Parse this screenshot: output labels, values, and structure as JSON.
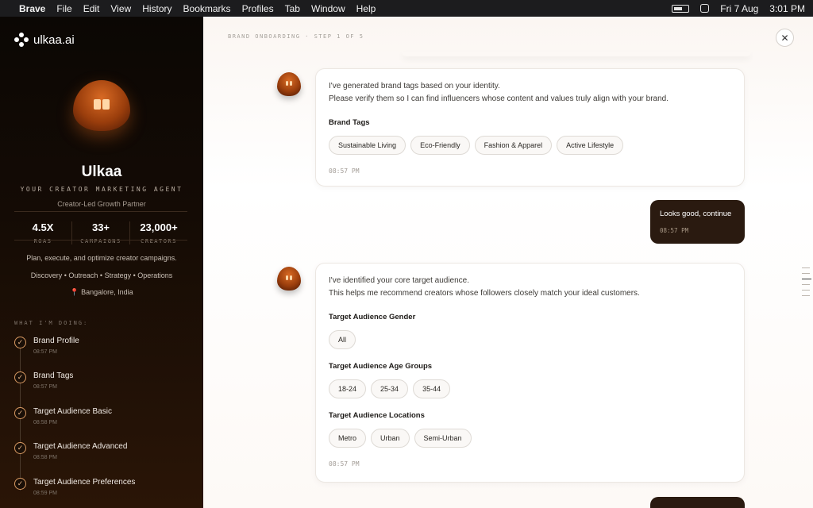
{
  "menubar": {
    "app": "Brave",
    "items": [
      "File",
      "Edit",
      "View",
      "History",
      "Bookmarks",
      "Profiles",
      "Tab",
      "Window",
      "Help"
    ],
    "date": "Fri 7 Aug",
    "time": "3:01 PM"
  },
  "sidebar": {
    "logo": "ulkaa.ai",
    "name": "Ulkaa",
    "role": "YOUR CREATOR MARKETING AGENT",
    "subtitle": "Creator-Led Growth Partner",
    "stats": [
      {
        "value": "4.5X",
        "label": "ROAS"
      },
      {
        "value": "33+",
        "label": "CAMPAIGNS"
      },
      {
        "value": "23,000+",
        "label": "CREATORS"
      }
    ],
    "tagline": "Plan, execute, and optimize creator campaigns.",
    "services": "Discovery • Outreach • Strategy • Operations",
    "location": "📍 Bangalore, India",
    "doing_label": "WHAT I'M DOING:",
    "steps": [
      {
        "title": "Brand Profile",
        "time": "08:57 PM"
      },
      {
        "title": "Brand Tags",
        "time": "08:57 PM"
      },
      {
        "title": "Target Audience Basic",
        "time": "08:58 PM"
      },
      {
        "title": "Target Audience Advanced",
        "time": "08:58 PM"
      },
      {
        "title": "Target Audience Preferences",
        "time": "08:59 PM"
      }
    ]
  },
  "main": {
    "step_label": "BRAND ONBOARDING · STEP 1 OF 5",
    "close_symbol": "✕",
    "card1": {
      "line1": "I've generated brand tags based on your identity.",
      "line2": "Please verify them so I can find influencers whose content and values truly align with your brand.",
      "heading": "Brand Tags",
      "tags": [
        "Sustainable Living",
        "Eco-Friendly",
        "Fashion & Apparel",
        "Active Lifestyle"
      ],
      "time": "08:57 PM"
    },
    "user1": {
      "text": "Looks good, continue",
      "time": "08:57 PM"
    },
    "card2": {
      "line1": "I've identified your core target audience.",
      "line2": "This helps me recommend creators whose followers closely match your ideal customers.",
      "gender_heading": "Target Audience Gender",
      "gender": [
        "All"
      ],
      "age_heading": "Target Audience Age Groups",
      "ages": [
        "18-24",
        "25-34",
        "35-44"
      ],
      "loc_heading": "Target Audience Locations",
      "locations": [
        "Metro",
        "Urban",
        "Semi-Urban"
      ],
      "time": "08:57 PM"
    }
  }
}
